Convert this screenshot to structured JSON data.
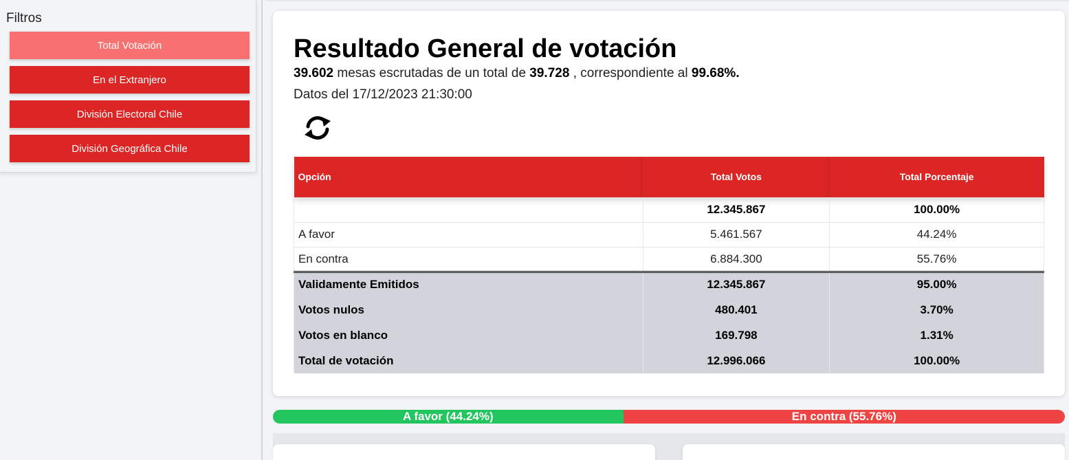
{
  "sidebar": {
    "title": "Filtros",
    "filters": [
      {
        "label": "Total Votación",
        "active": true
      },
      {
        "label": "En el Extranjero",
        "active": false
      },
      {
        "label": "División Electoral Chile",
        "active": false
      },
      {
        "label": "División Geográfica Chile",
        "active": false
      }
    ]
  },
  "main": {
    "title": "Resultado General de votación",
    "summary": {
      "mesas_escrutadas": "39.602",
      "text_1": "mesas escrutadas de un total de",
      "total_mesas": "39.728",
      "text_2": ", correspondiente al",
      "porcentaje": "99.68%."
    },
    "datos": "Datos del 17/12/2023 21:30:00",
    "refresh_icon": "refresh-icon"
  },
  "table": {
    "headers": [
      "Opción",
      "Total Votos",
      "Total Porcentaje"
    ],
    "rows": [
      [
        "",
        "12.345.867",
        "100.00%"
      ],
      [
        "A favor",
        "5.461.567",
        "44.24%"
      ],
      [
        "En contra",
        "6.884.300",
        "55.76%"
      ]
    ],
    "totals": [
      [
        "Validamente Emitidos",
        "12.345.867",
        "95.00%"
      ],
      [
        "Votos nulos",
        "480.401",
        "3.70%"
      ],
      [
        "Votos en blanco",
        "169.798",
        "1.31%"
      ],
      [
        "Total de votación",
        "12.996.066",
        "100.00%"
      ]
    ]
  },
  "vote_bar": {
    "favor_label": "A favor (44.24%)",
    "favor_fraction": 0.4424,
    "contra_label": "En contra (55.76%)",
    "contra_fraction": 0.5576
  },
  "colors": {
    "accent": "#dc2626",
    "active_filter": "#f87171",
    "favor": "#22c55e",
    "contra": "#ef4444",
    "totals_row_bg": "#d1d5db"
  }
}
